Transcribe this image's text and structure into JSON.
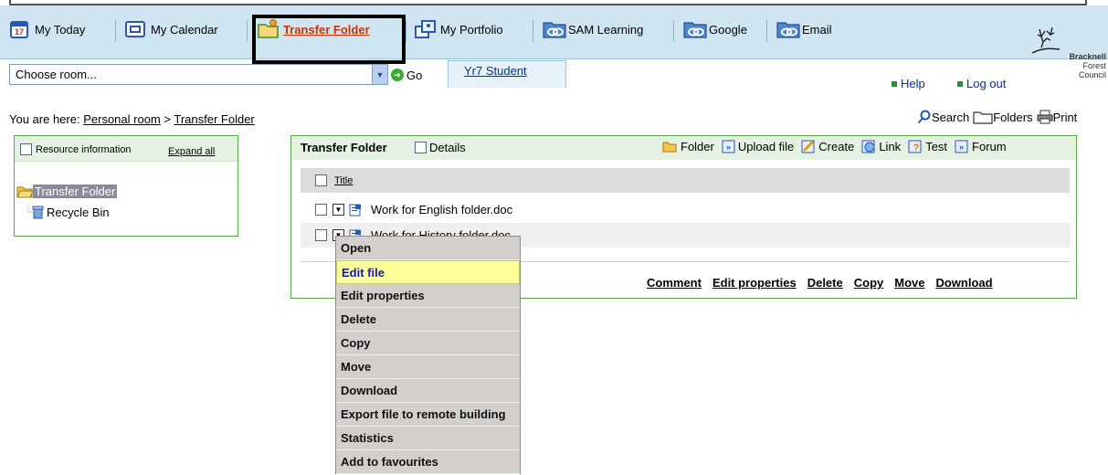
{
  "nav": {
    "items": [
      {
        "label": "My Today",
        "icon": "calendar-day-icon"
      },
      {
        "label": "My Calendar",
        "icon": "calendar-icon"
      },
      {
        "label": "Transfer Folder",
        "icon": "transfer-folder-icon",
        "active": true
      },
      {
        "label": "My Portfolio",
        "icon": "portfolio-icon"
      },
      {
        "label": "SAM Learning",
        "icon": "link-icon"
      },
      {
        "label": "Google",
        "icon": "link-icon"
      },
      {
        "label": "Email",
        "icon": "link-icon"
      }
    ],
    "logo_lines": [
      "Bracknell",
      "Forest",
      "Council"
    ]
  },
  "toolbar": {
    "room_select": "Choose room...",
    "go_label": "Go",
    "user_tab": "Yr7 Student",
    "help_label": "Help",
    "logout_label": "Log out"
  },
  "breadcrumb": {
    "prefix": "You are here:",
    "items": [
      "Personal room",
      "Transfer Folder"
    ],
    "separator": ">"
  },
  "tools": {
    "search_label": "Search",
    "folders_label": "Folders",
    "print_label": "Print"
  },
  "left_panel": {
    "resource_info": "Resource information",
    "expand_all": "Expand all",
    "tree": [
      "Transfer Folder",
      "Recycle Bin"
    ]
  },
  "main_panel": {
    "title": "Transfer Folder",
    "details_label": "Details",
    "actions": [
      "Folder",
      "Upload file",
      "Create",
      "Link",
      "Test",
      "Forum"
    ],
    "column_title": "Title",
    "files": [
      "Work for English folder.doc",
      "Work for History folder.doc"
    ],
    "bottom_links": [
      "Comment",
      "Edit properties",
      "Delete",
      "Copy",
      "Move",
      "Download"
    ]
  },
  "context_menu": {
    "items": [
      "Open",
      "Edit file",
      "Edit properties",
      "Delete",
      "Copy",
      "Move",
      "Download",
      "Export file to remote building",
      "Statistics",
      "Add to favourites"
    ],
    "active": "Edit file"
  },
  "colors": {
    "nav_bg": "#cfe6f2",
    "panel_border": "#5aa64b",
    "active_nav": "#cc3300",
    "menu_bg": "#d3cfcc",
    "menu_highlight": "#ffff99"
  }
}
